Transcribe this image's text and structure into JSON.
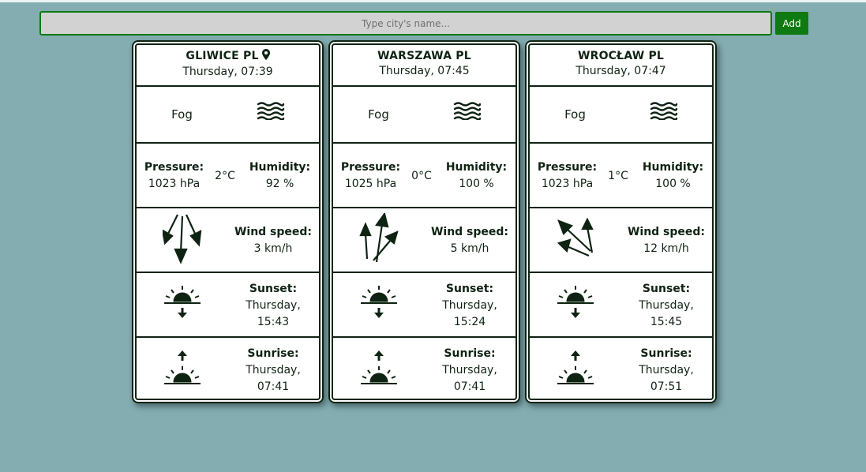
{
  "search": {
    "placeholder": "Type city's name...",
    "add_label": "Add"
  },
  "colors": {
    "background": "#84adb2",
    "accent": "#0e7a11",
    "ink": "#0f2312"
  },
  "labels": {
    "pressure": "Pressure:",
    "humidity": "Humidity:",
    "wind_speed": "Wind speed:",
    "sunset": "Sunset:",
    "sunrise": "Sunrise:"
  },
  "cards": [
    {
      "city": "GLIWICE PL",
      "has_location_pin": true,
      "datetime": "Thursday, 07:39",
      "description": "Fog",
      "weather_icon": "fog-icon",
      "pressure": "1023 hPa",
      "temperature": "2°C",
      "humidity": "92 %",
      "wind_icon": "wind-arrows-down-icon",
      "wind_speed": "3 km/h",
      "sunset_day": "Thursday,",
      "sunset_time": "15:43",
      "sunrise_day": "Thursday,",
      "sunrise_time": "07:41"
    },
    {
      "city": "WARSZAWA PL",
      "has_location_pin": false,
      "datetime": "Thursday, 07:45",
      "description": "Fog",
      "weather_icon": "fog-icon",
      "pressure": "1025 hPa",
      "temperature": "0°C",
      "humidity": "100 %",
      "wind_icon": "wind-arrows-up-icon",
      "wind_speed": "5 km/h",
      "sunset_day": "Thursday,",
      "sunset_time": "15:24",
      "sunrise_day": "Thursday,",
      "sunrise_time": "07:41"
    },
    {
      "city": "WROCŁAW PL",
      "has_location_pin": false,
      "datetime": "Thursday, 07:47",
      "description": "Fog",
      "weather_icon": "fog-icon",
      "pressure": "1023 hPa",
      "temperature": "1°C",
      "humidity": "100 %",
      "wind_icon": "wind-arrows-upleft-icon",
      "wind_speed": "12 km/h",
      "sunset_day": "Thursday,",
      "sunset_time": "15:45",
      "sunrise_day": "Thursday,",
      "sunrise_time": "07:51"
    }
  ]
}
